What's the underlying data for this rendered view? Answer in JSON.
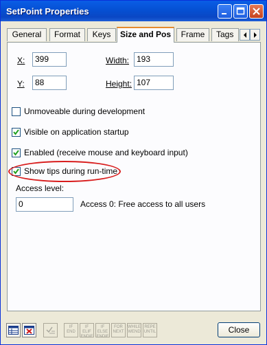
{
  "window": {
    "title": "SetPoint Properties"
  },
  "tabs": [
    {
      "label": "General"
    },
    {
      "label": "Format"
    },
    {
      "label": "Keys"
    },
    {
      "label": "Size and Pos",
      "active": true
    },
    {
      "label": "Frame"
    },
    {
      "label": "Tags"
    }
  ],
  "fields": {
    "x": {
      "label": "X:",
      "value": "399"
    },
    "y": {
      "label": "Y:",
      "value": "88"
    },
    "width": {
      "label": "Width:",
      "value": "193"
    },
    "height": {
      "label": "Height:",
      "value": "107"
    }
  },
  "checkboxes": {
    "unmoveable": {
      "label": "Unmoveable during development",
      "checked": false
    },
    "visible": {
      "label": "Visible on application startup",
      "checked": true
    },
    "enabled": {
      "label": "Enabled (receive mouse and keyboard input)",
      "checked": true
    },
    "show_tips": {
      "label": "Show tips during run-time",
      "checked": true
    }
  },
  "access": {
    "label": "Access level:",
    "value": "0",
    "description": "Access 0: Free access to all users"
  },
  "toolbar": {
    "items": [
      {
        "icon": "table-icon",
        "enabled": true
      },
      {
        "icon": "delete-table-icon",
        "enabled": true
      },
      {
        "icon": "check-list-icon",
        "enabled": false
      },
      {
        "lines": [
          "IF",
          "END"
        ],
        "enabled": false
      },
      {
        "lines": [
          "IF",
          "ELIF",
          "ENDIF"
        ],
        "enabled": false
      },
      {
        "lines": [
          "IF",
          "ELSE",
          "ENDIF"
        ],
        "enabled": false
      },
      {
        "lines": [
          "FOR",
          "NEXT"
        ],
        "enabled": false
      },
      {
        "lines": [
          "WHILE",
          "WEND"
        ],
        "enabled": false
      },
      {
        "lines": [
          "REPE",
          "UNTIL"
        ],
        "enabled": false
      }
    ],
    "close_label": "Close"
  }
}
